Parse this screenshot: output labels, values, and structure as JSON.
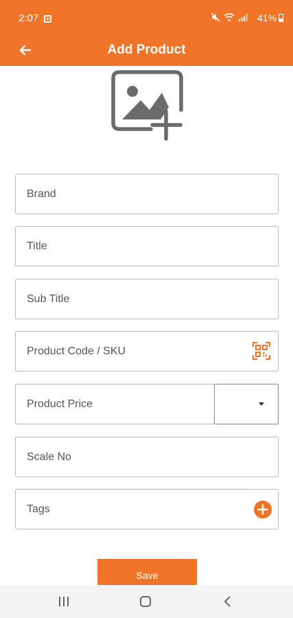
{
  "status_bar": {
    "time": "2:07",
    "battery": "41%",
    "icons": [
      "notification-icon",
      "mute-icon",
      "wifi-icon",
      "signal-icon",
      "battery-icon"
    ]
  },
  "header": {
    "title": "Add Product",
    "back_icon": "arrow-left-icon"
  },
  "image_picker": {
    "icon": "add-image-icon"
  },
  "form": {
    "brand_placeholder": "Brand",
    "title_placeholder": "Title",
    "subtitle_placeholder": "Sub Title",
    "sku_placeholder": "Product Code / SKU",
    "sku_icon": "qr-scan-icon",
    "price_placeholder": "Product Price",
    "currency_value": "",
    "scale_placeholder": "Scale No",
    "tags_placeholder": "Tags",
    "tags_icon": "add-circle-icon"
  },
  "actions": {
    "save_label": "Save"
  },
  "nav_bar": {
    "icons": [
      "recents-icon",
      "home-icon",
      "back-icon"
    ]
  },
  "colors": {
    "accent": "#f07428",
    "border": "#b8b8b8",
    "placeholder": "#555555",
    "navbar": "#f4f4f4"
  }
}
